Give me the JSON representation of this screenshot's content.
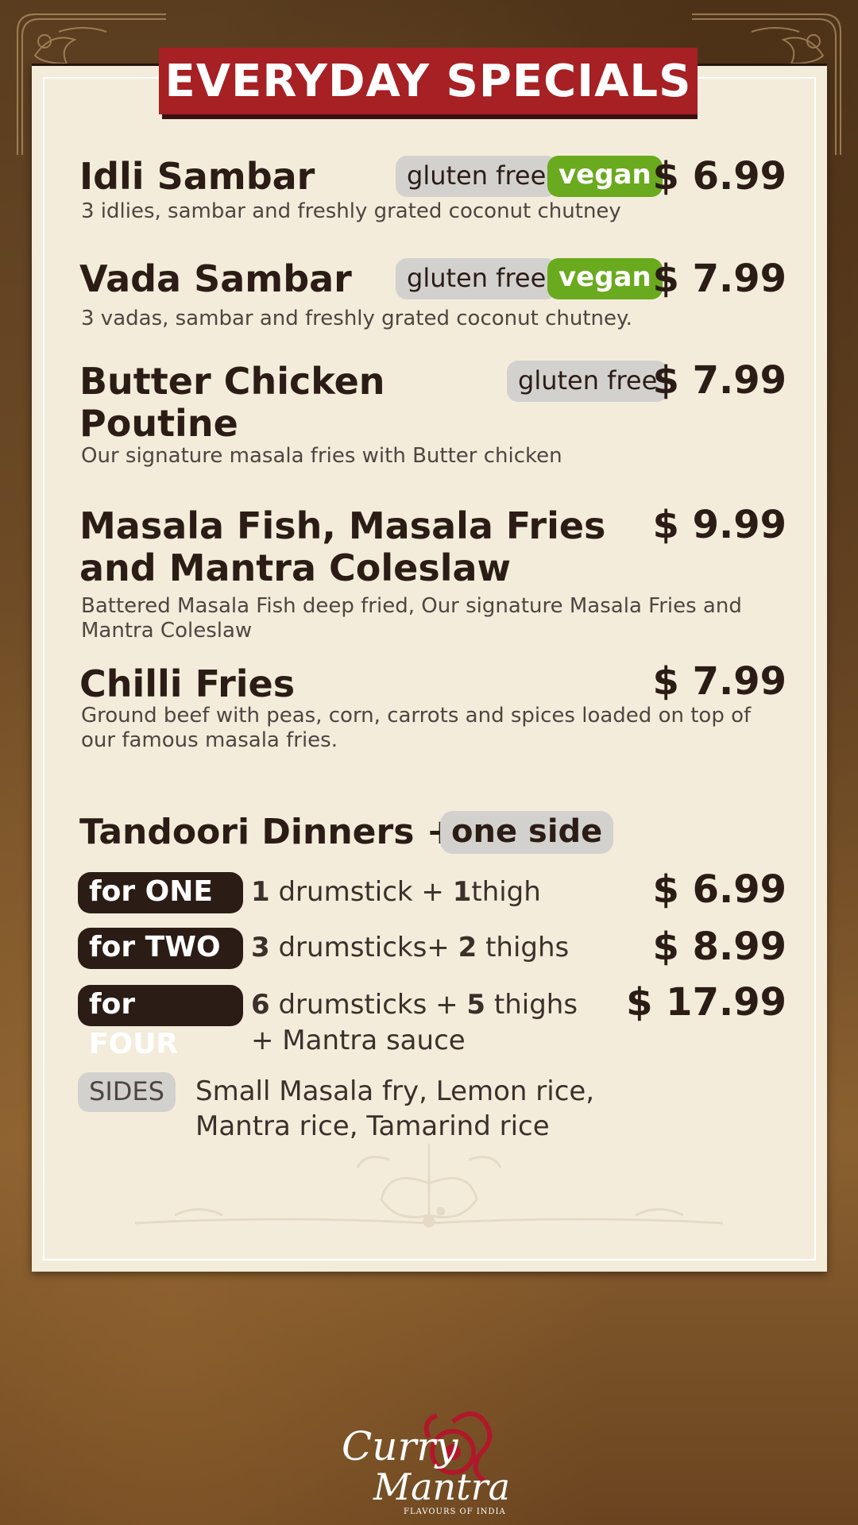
{
  "banner": {
    "title": "EVERYDAY SPECIALS"
  },
  "items": [
    {
      "name": "Idli Sambar",
      "tags": [
        "gluten free",
        "vegan"
      ],
      "price": "$ 6.99",
      "description": "3 idlies, sambar and freshly grated coconut chutney"
    },
    {
      "name": "Vada Sambar",
      "tags": [
        "gluten free",
        "vegan"
      ],
      "price": "$ 7.99",
      "description": "3 vadas, sambar and freshly grated coconut chutney."
    },
    {
      "name_line1": "Butter Chicken",
      "name_line2": "Poutine",
      "tags": [
        "gluten free"
      ],
      "price": "$ 7.99",
      "description": "Our signature masala fries with Butter chicken"
    },
    {
      "name_line1": "Masala Fish, Masala Fries",
      "name_line2": "and Mantra Coleslaw",
      "price": "$ 9.99",
      "description_line1": "Battered Masala Fish deep fried, Our signature Masala Fries and",
      "description_line2": "Mantra Coleslaw"
    },
    {
      "name": "Chilli Fries",
      "price": "$ 7.99",
      "description_line1": "Ground beef with peas, corn, carrots and spices loaded on top of",
      "description_line2": "our famous masala fries."
    }
  ],
  "tandoori": {
    "title": "Tandoori Dinners +",
    "side_badge": "one side",
    "options": [
      {
        "label": "for ONE",
        "n1": "1",
        "t1": " drumstick + ",
        "n2": "1",
        "t2": "thigh",
        "price": "$ 6.99"
      },
      {
        "label": "for TWO",
        "n1": "3",
        "t1": " drumsticks",
        "plus": "+",
        "n2": "2",
        "t2": " thighs",
        "price": "$ 8.99"
      },
      {
        "label": "for FOUR",
        "n1": "6",
        "t1": " drumsticks + ",
        "n2": "5",
        "t2": " thighs",
        "extra": "+ Mantra sauce",
        "price": "$ 17.99"
      }
    ],
    "sides_label": "SIDES",
    "sides_line1": "Small Masala fry, Lemon rice,",
    "sides_line2": "Mantra rice, Tamarind rice"
  },
  "logo": {
    "line1": "Curry",
    "line2": "Mantra",
    "tagline": "FLAVOURS OF INDIA"
  }
}
